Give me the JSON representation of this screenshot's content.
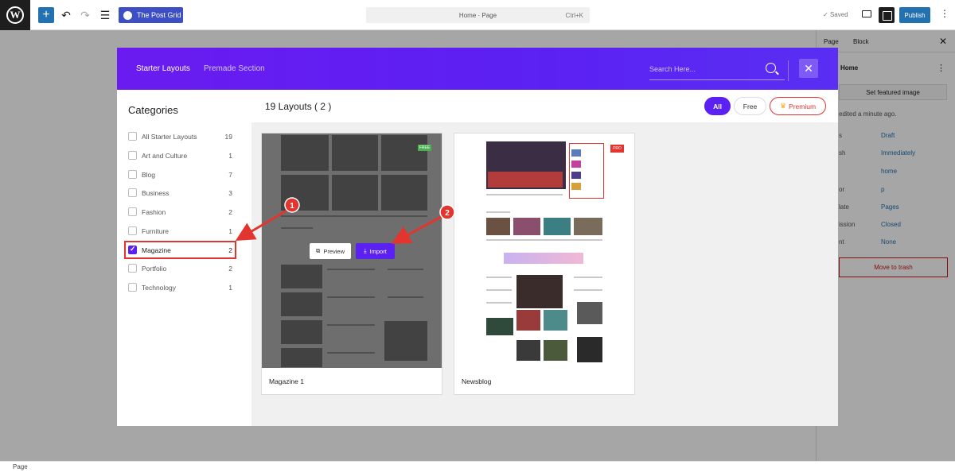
{
  "editor": {
    "plugin_label": "The Post Grid",
    "doc_title": "Home · Page",
    "doc_shortcut": "Ctrl+K",
    "saved_label": "Saved",
    "publish_label": "Publish",
    "status_bar": "Page"
  },
  "sidebar": {
    "tab_page": "Page",
    "tab_block": "Block",
    "page_title": "Home",
    "featured_image": "Set featured image",
    "edited": "edited a minute ago.",
    "rows": [
      {
        "label": "s",
        "value": "Draft"
      },
      {
        "label": "sh",
        "value": "Immediately"
      },
      {
        "label": "",
        "value": "home"
      },
      {
        "label": "or",
        "value": "p"
      },
      {
        "label": "late",
        "value": "Pages"
      },
      {
        "label": "ission",
        "value": "Closed"
      },
      {
        "label": "nt",
        "value": "None"
      }
    ],
    "trash": "Move to trash"
  },
  "modal": {
    "tabs": [
      "Starter Layouts",
      "Premade Section"
    ],
    "search_placeholder": "Search Here...",
    "close": "✕",
    "categories_title": "Categories",
    "categories": [
      {
        "label": "All Starter Layouts",
        "count": "19",
        "checked": false
      },
      {
        "label": "Art and Culture",
        "count": "1",
        "checked": false
      },
      {
        "label": "Blog",
        "count": "7",
        "checked": false
      },
      {
        "label": "Business",
        "count": "3",
        "checked": false
      },
      {
        "label": "Fashion",
        "count": "2",
        "checked": false
      },
      {
        "label": "Furniture",
        "count": "1",
        "checked": false
      },
      {
        "label": "Magazine",
        "count": "2",
        "checked": true
      },
      {
        "label": "Portfolio",
        "count": "2",
        "checked": false
      },
      {
        "label": "Technology",
        "count": "1",
        "checked": false
      }
    ],
    "layouts_title": "19 Layouts ( 2 )",
    "filters": {
      "all": "All",
      "free": "Free",
      "premium": "Premium"
    },
    "cards": [
      {
        "name": "Magazine 1",
        "tag": "FREE",
        "preview": "Preview",
        "import": "Import"
      },
      {
        "name": "Newsblog",
        "tag": "PRO"
      }
    ]
  },
  "annotations": [
    {
      "number": "1"
    },
    {
      "number": "2"
    }
  ],
  "colors": {
    "accent": "#5b21f3",
    "annotation": "#e3352f",
    "wp_blue": "#2271b1"
  }
}
